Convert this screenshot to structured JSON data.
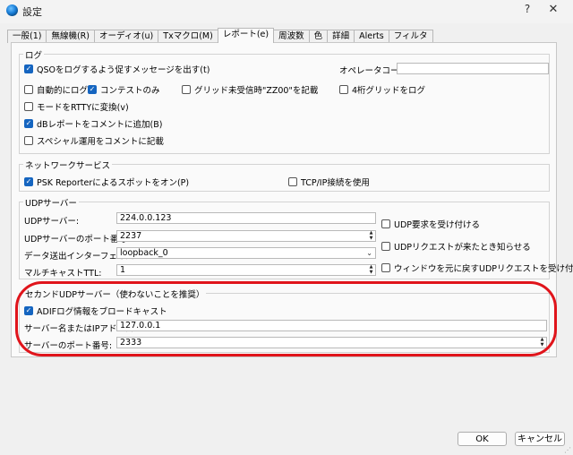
{
  "window": {
    "title": "設定",
    "help": "?",
    "close": "✕"
  },
  "tabs": [
    "一般(1)",
    "無線機(R)",
    "オーディオ(u)",
    "Txマクロ(M)",
    "レポート(e)",
    "周波数",
    "色",
    "詳細",
    "Alerts",
    "フィルタ"
  ],
  "log": {
    "title": "ログ",
    "prompt_qso": "QSOをログするよう促すメッセージを出す(t)",
    "operator_label": "オペレータコール:",
    "operator_value": "",
    "auto_log": "自動的にログ",
    "contest_only": "コンテストのみ",
    "grid_zz00": "グリッド未受信時\"ZZ00\"を記載",
    "four_grid": "4桁グリッドをログ",
    "rtty_mode": "モードをRTTYに変換(v)",
    "db_comment": "dBレポートをコメントに追加(B)",
    "special_op": "スペシャル運用をコメントに記載"
  },
  "network": {
    "title": "ネットワークサービス",
    "psk": "PSK Reporterによるスポットをオン(P)",
    "tcpip": "TCP/IP接続を使用"
  },
  "udp": {
    "title": "UDPサーバー",
    "server_label": "UDPサーバー:",
    "server_value": "224.0.0.123",
    "port_label": "UDPサーバーのポート番号:",
    "port_value": "2237",
    "iface_label": "データ送出インターフェイス:",
    "iface_value": "loopback_0",
    "ttl_label": "マルチキャストTTL:",
    "ttl_value": "1",
    "accept_requests": "UDP要求を受け付ける",
    "notify_requests": "UDPリクエストが来たとき知らせる",
    "restore_window": "ウィンドウを元に戻すUDPリクエストを受け付ける"
  },
  "second_udp": {
    "title": "セカンドUDPサーバー（使わないことを推奨）",
    "adif": "ADIFログ情報をブロードキャスト",
    "host_label": "サーバー名またはIPアドレス:",
    "host_value": "127.0.0.1",
    "port_label": "サーバーのポート番号:",
    "port_value": "2333"
  },
  "buttons": {
    "ok": "OK",
    "cancel": "キャンセル"
  },
  "colors": {
    "accent": "#1565c0",
    "highlight": "#e0141b"
  }
}
